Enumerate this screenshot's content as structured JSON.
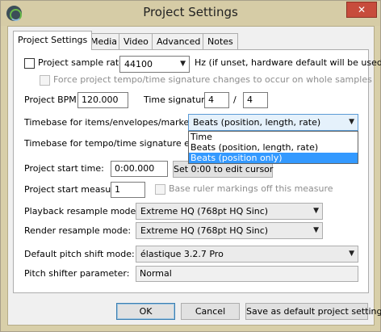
{
  "window": {
    "title": "Project Settings",
    "close_glyph": "✕",
    "app_icon": "reaper-app-icon"
  },
  "tabs": [
    {
      "label": "Project Settings",
      "active": true
    },
    {
      "label": "Media",
      "active": false
    },
    {
      "label": "Video",
      "active": false
    },
    {
      "label": "Advanced",
      "active": false
    },
    {
      "label": "Notes",
      "active": false
    }
  ],
  "sample_rate": {
    "checkbox_label": "Project sample rate:",
    "checked": false,
    "value": "44100",
    "hint": "Hz (if unset, hardware default will be used)",
    "force_label": "Force project tempo/time signature changes to occur on whole samples",
    "force_checked": false
  },
  "tempo": {
    "bpm_label": "Project BPM:",
    "bpm_value": "120.000",
    "timesig_label": "Time signature",
    "timesig_num": "4",
    "timesig_sep": "/",
    "timesig_den": "4"
  },
  "timebase": {
    "items_label": "Timebase for items/envelopes/markers:",
    "items_value": "Beats (position, length, rate)",
    "tempo_label": "Timebase for tempo/time signature envelope:",
    "options": [
      "Time",
      "Beats (position, length, rate)",
      "Beats (position only)"
    ],
    "highlighted_option": "Beats (position only)"
  },
  "start": {
    "time_label": "Project start time:",
    "time_value": "0:00.000",
    "set_button": "Set 0:00 to edit cursor",
    "measure_label": "Project start measure:",
    "measure_value": "1",
    "ruler_label": "Base ruler markings off this measure",
    "ruler_checked": false
  },
  "resample": {
    "playback_label": "Playback resample mode:",
    "playback_value": "Extreme HQ (768pt HQ Sinc)",
    "render_label": "Render resample mode:",
    "render_value": "Extreme HQ (768pt HQ Sinc)"
  },
  "pitch": {
    "mode_label": "Default pitch shift mode:",
    "mode_value": "élastique 3.2.7 Pro",
    "param_label": "Pitch shifter parameter:",
    "param_value": "Normal"
  },
  "footer": {
    "ok": "OK",
    "cancel": "Cancel",
    "save_default": "Save as default project settings"
  },
  "icons": {
    "dropdown_arrow": "▼"
  }
}
